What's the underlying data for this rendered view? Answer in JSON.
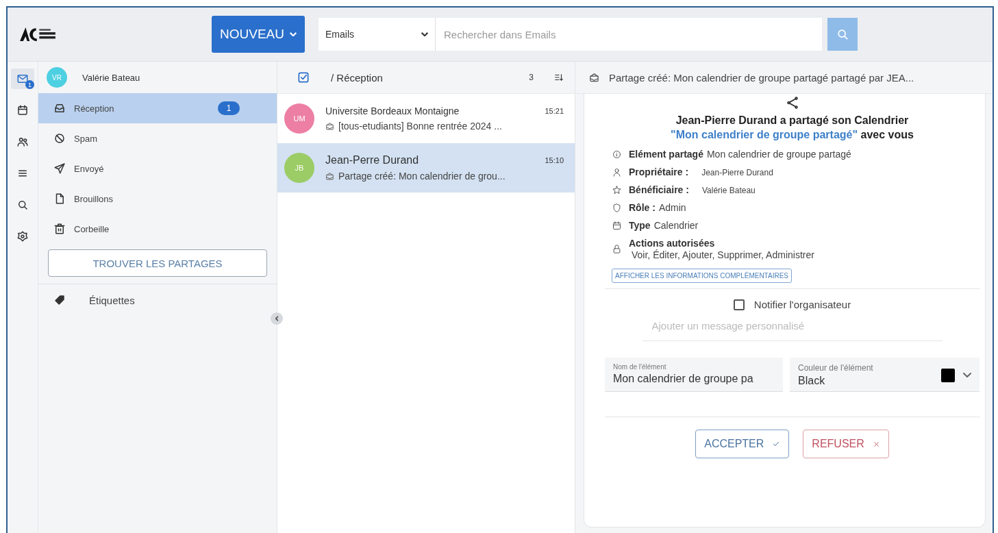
{
  "header": {
    "new_button": "NOUVEAU",
    "search_scope": "Emails",
    "search": {
      "placeholder": "Rechercher dans Emails"
    }
  },
  "rail": [
    {
      "kind": "mail",
      "selected": true,
      "badge": "1"
    },
    {
      "kind": "calendar",
      "selected": false
    },
    {
      "kind": "contacts",
      "selected": false
    },
    {
      "kind": "list",
      "selected": false
    },
    {
      "kind": "search",
      "selected": false
    },
    {
      "kind": "settings",
      "selected": false
    }
  ],
  "account": {
    "initials": "VR",
    "color": "#4dd0e1",
    "name": "Valérie Bateau"
  },
  "folders": [
    {
      "kind": "inbox",
      "label": "Réception",
      "selected": true,
      "count": "1"
    },
    {
      "kind": "spam",
      "label": "Spam",
      "selected": false
    },
    {
      "kind": "sent",
      "label": "Envoyé",
      "selected": false
    },
    {
      "kind": "drafts",
      "label": "Brouillons",
      "selected": false
    },
    {
      "kind": "trash",
      "label": "Corbeille",
      "selected": false
    }
  ],
  "find_shares_button": "TROUVER LES PARTAGES",
  "labels_section": "Étiquettes",
  "mail_list": {
    "path": "/ Réception",
    "count": "3",
    "messages": [
      {
        "initials": "UM",
        "color": "#ec7fa3",
        "sender": "Universite Bordeaux Montaigne",
        "time": "15:21",
        "subject": "[tous-etudiants] Bonne rentrée 2024 ...",
        "selected": false
      },
      {
        "initials": "JB",
        "color": "#9ccc65",
        "sender": "Jean-Perre Durand",
        "time": "15:10",
        "subject": "Partage créé: Mon calendrier de grou...",
        "selected": true
      }
    ]
  },
  "reader": {
    "subject": "Partage créé: Mon calendrier de groupe partagé partagé par JEA...",
    "heading": {
      "owner": "Jean-Pierre Durand",
      "text": "a partagé son Calendrier",
      "item": "\"Mon calendrier de groupe partagé\"",
      "suffix": "avec vous"
    },
    "details": [
      {
        "kind": "info",
        "label": "Elément partagé",
        "value": "Mon calendrier de groupe partagé",
        "stacked": false
      },
      {
        "kind": "person",
        "label": "Propriétaire :",
        "value": "Jean-Pierre Durand",
        "stacked": false
      },
      {
        "kind": "star",
        "label": "Bénéficiaire :",
        "value": "Valérie Bateau",
        "stacked": false
      },
      {
        "kind": "shield",
        "label": "Rôle :",
        "value": "Admin",
        "stacked": false
      },
      {
        "kind": "calendar",
        "label": "Type",
        "value": "Calendrier",
        "stacked": false
      },
      {
        "kind": "lock",
        "label": "Actions autorisées",
        "value": "Voir, Éditer, Ajouter, Supprimer, Administrer",
        "stacked": true
      }
    ],
    "more_button": "AFFICHER LES INFORMATIONS COMPLÉMENTAIRES",
    "notify": {
      "label": "Notifier l'organisateur",
      "checked": false
    },
    "message": {
      "placeholder": "Ajouter un message personnalisé"
    },
    "name_field": {
      "label": "Nom de l'élément",
      "value": "Mon calendrier de groupe pa"
    },
    "color_field": {
      "label": "Couleur de l'élément",
      "value": "Black",
      "color": "#000000"
    },
    "accept_button": "ACCEPTER",
    "refuse_button": "REFUSER"
  }
}
